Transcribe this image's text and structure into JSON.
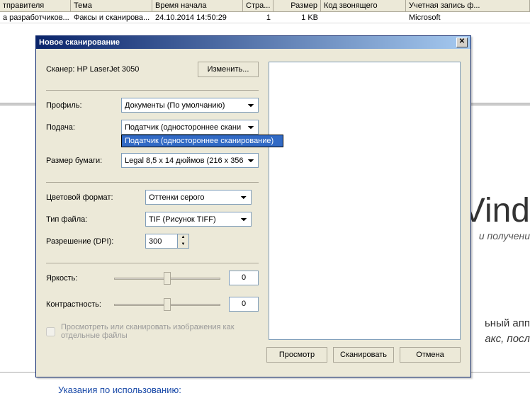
{
  "table": {
    "headers": [
      "тправителя",
      "Тема",
      "Время начала",
      "Стра...",
      "Размер",
      "Код звонящего",
      "Учетная запись ф..."
    ],
    "row": [
      "а разработчиков...",
      "Факсы и сканирова...",
      "24.10.2014 14:50:29",
      "1",
      "1 KB",
      "",
      "Microsoft"
    ]
  },
  "background": {
    "watermark": "Vind",
    "subwatermark": "и получени",
    "text2": "ьный апп",
    "text3": "акс, посл",
    "help_link": "Указания по использованию:"
  },
  "dialog": {
    "title": "Новое сканирование",
    "scanner_label": "Сканер: HP LaserJet 3050",
    "change_btn": "Изменить...",
    "profile_label": "Профиль:",
    "profile_value": "Документы (По умолчанию)",
    "feed_label": "Подача:",
    "feed_value": "Податчик (одностороннее скани",
    "feed_popup": "Податчик (одностороннее сканирование)",
    "papersize_label": "Размер бумаги:",
    "papersize_value": "Legal 8,5 x 14 дюймов (216 x 356 м",
    "colorformat_label": "Цветовой формат:",
    "colorformat_value": "Оттенки серого",
    "filetype_label": "Тип файла:",
    "filetype_value": "TIF (Рисунок TIFF)",
    "dpi_label": "Разрешение (DPI):",
    "dpi_value": "300",
    "brightness_label": "Яркость:",
    "brightness_value": "0",
    "contrast_label": "Контрастность:",
    "contrast_value": "0",
    "checkbox_label": "Просмотреть или сканировать изображения как отдельные файлы",
    "preview_btn": "Просмотр",
    "scan_btn": "Сканировать",
    "cancel_btn": "Отмена"
  }
}
